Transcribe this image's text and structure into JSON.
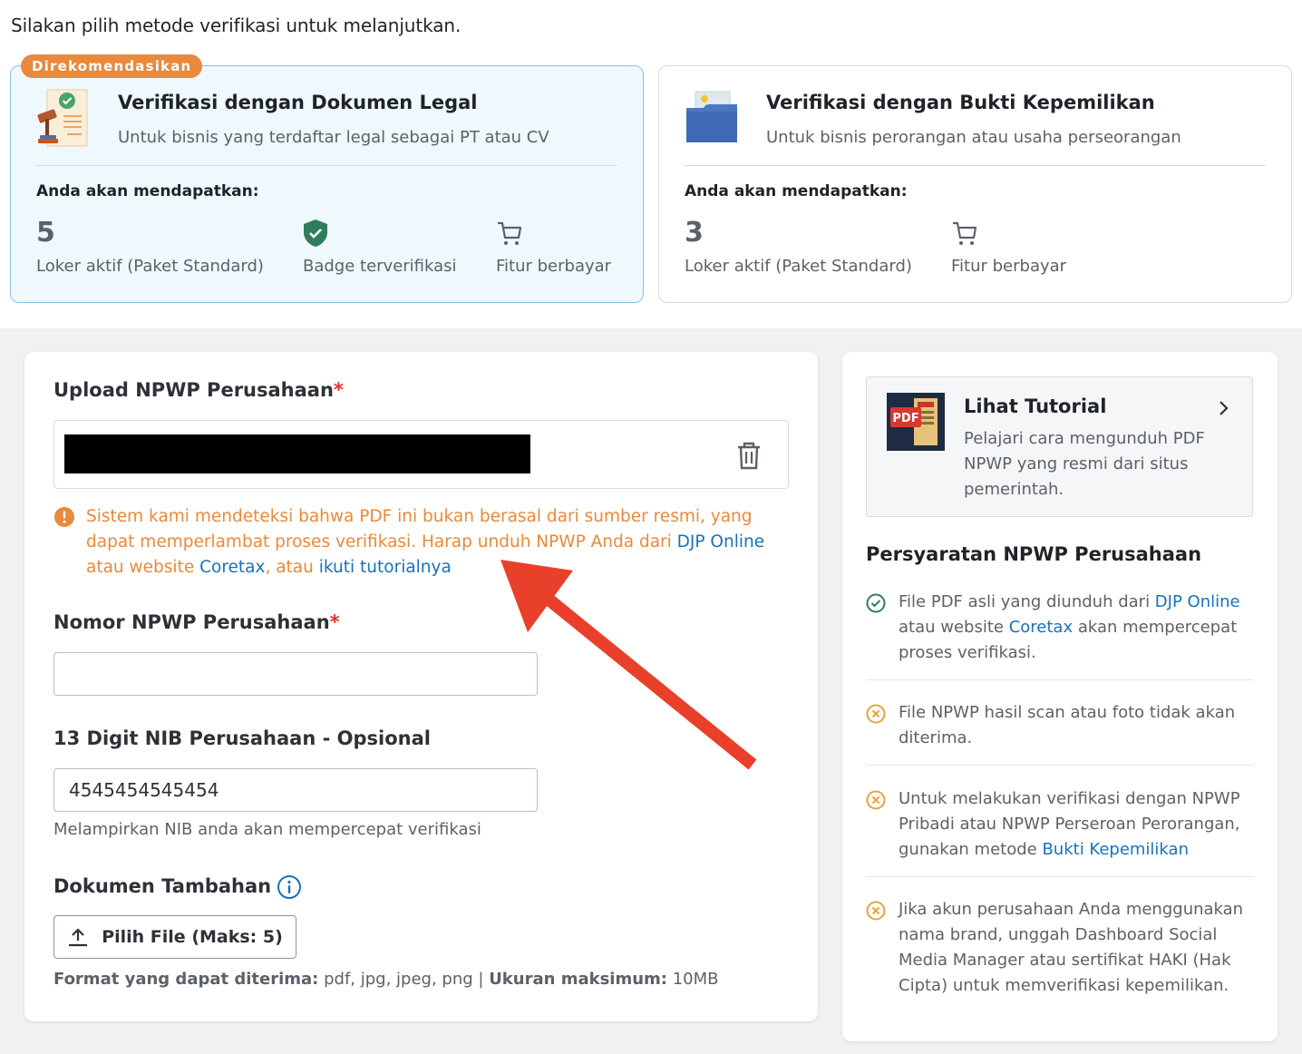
{
  "intro": "Silakan pilih metode verifikasi untuk melanjutkan.",
  "methods": [
    {
      "badge": "Direkomendasikan",
      "title": "Verifikasi dengan Dokumen Legal",
      "subtitle": "Untuk bisnis yang terdaftar legal sebagai PT atau CV",
      "benefits_heading": "Anda akan mendapatkan:",
      "benefits": [
        {
          "value": "5",
          "label": "Loker aktif (Paket Standard)"
        },
        {
          "icon": "shield-check-icon",
          "label": "Badge terverifikasi"
        },
        {
          "icon": "cart-icon",
          "label": "Fitur berbayar"
        }
      ]
    },
    {
      "title": "Verifikasi dengan Bukti Kepemilikan",
      "subtitle": "Untuk bisnis perorangan atau usaha perseorangan",
      "benefits_heading": "Anda akan mendapatkan:",
      "benefits": [
        {
          "value": "3",
          "label": "Loker aktif (Paket Standard)"
        },
        {
          "icon": "cart-icon",
          "label": "Fitur berbayar"
        }
      ]
    }
  ],
  "form": {
    "upload_label": "Upload NPWP Perusahaan",
    "required_mark": "*",
    "warning": {
      "part1": "Sistem kami mendeteksi bahwa PDF ini bukan berasal dari sumber resmi, yang dapat memperlambat proses verifikasi. Harap unduh NPWP Anda dari ",
      "link1": "DJP Online",
      "part2": " atau website ",
      "link2": "Coretax",
      "part3": ", atau ",
      "link3": "ikuti tutorialnya"
    },
    "npwp_label": "Nomor NPWP Perusahaan",
    "npwp_value": "",
    "nib_label": "13 Digit NIB Perusahaan - Opsional",
    "nib_value": "4545454545454",
    "nib_hint": "Melampirkan NIB anda akan mempercepat verifikasi",
    "extra_docs_label": "Dokumen Tambahan",
    "choose_file_button": "Pilih File (Maks: 5)",
    "formats_label": "Format yang dapat diterima:",
    "formats_value": " pdf, jpg, jpeg, png | ",
    "max_size_label": "Ukuran maksimum:",
    "max_size_value": " 10MB"
  },
  "sidebar": {
    "tutorial_title": "Lihat Tutorial",
    "tutorial_desc": "Pelajari cara mengunduh PDF NPWP yang resmi dari situs pemerintah.",
    "pdf_icon_label": "PDF",
    "requirements_heading": "Persyaratan NPWP Perusahaan",
    "req1": {
      "t1": "File PDF asli yang diunduh dari ",
      "l1": "DJP Online",
      "t2": " atau website ",
      "l2": "Coretax",
      "t3": " akan mempercepat proses verifikasi."
    },
    "req2": "File NPWP hasil scan atau foto tidak akan diterima.",
    "req3": {
      "t1": "Untuk melakukan verifikasi dengan NPWP Pribadi atau NPWP Perseroan Perorangan, gunakan metode ",
      "l1": "Bukti Kepemilikan"
    },
    "req4": "Jika akun perusahaan Anda menggunakan nama brand, unggah Dashboard Social Media Manager atau sertifikat HAKI (Hak Cipta) untuk memverifikasi kepemilikan."
  },
  "colors": {
    "accent_blue": "#1c70b8",
    "warning_orange": "#e8893c",
    "required_red": "#e0322b",
    "success_green": "#2f7d5b",
    "selected_bg": "#eef8fd",
    "annotation_arrow": "#e8402a"
  }
}
